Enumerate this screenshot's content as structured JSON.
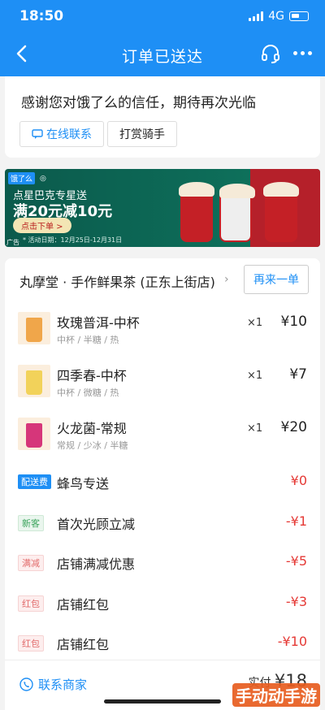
{
  "status_bar": {
    "time": "18:50",
    "network": "4G"
  },
  "nav": {
    "title": "订单已送达"
  },
  "thanks": {
    "message": "感谢您对饿了么的信任，期待再次光临",
    "online_contact": "在线联系",
    "tip_rider": "打赏骑手"
  },
  "banner": {
    "brand_logo": "饿了么",
    "title": "点星巴克专星送",
    "offer": "满20元减10元",
    "cta": "点击下单 >",
    "date": "* 活动日期：12月25日-12月31日",
    "ad_label": "广告"
  },
  "order": {
    "shop_name": "丸摩堂 · 手作鲜果茶 (正东上街店)",
    "reorder": "再来一单",
    "items": [
      {
        "name": "玫瑰普洱-中杯",
        "spec": "中杯 / 半糖 / 热",
        "qty": "×1",
        "price": "¥10",
        "color": "#f0a64a"
      },
      {
        "name": "四季春-中杯",
        "spec": "中杯 / 微糖 / 热",
        "qty": "×1",
        "price": "¥7",
        "color": "#f2d25a"
      },
      {
        "name": "火龙菌-常规",
        "spec": "常规 / 少冰 / 半糖",
        "qty": "×1",
        "price": "¥20",
        "color": "#d6367a"
      }
    ],
    "fees": [
      {
        "tag": "配送费",
        "name": "蜂鸟专送",
        "value": "¥0",
        "tag_style": "blue"
      },
      {
        "tag": "新客",
        "name": "首次光顾立减",
        "value": "-¥1",
        "tag_style": "green"
      },
      {
        "tag": "满减",
        "name": "店铺满减优惠",
        "value": "-¥5",
        "tag_style": "pink"
      },
      {
        "tag": "红包",
        "name": "店铺红包",
        "value": "-¥3",
        "tag_style": "pink"
      },
      {
        "tag": "红包",
        "name": "店铺红包",
        "value": "-¥10",
        "tag_style": "pink"
      }
    ],
    "contact_merchant": "联系商家",
    "paid_label": "实付",
    "paid_amount": "¥18"
  },
  "watermark": "手动动手游"
}
